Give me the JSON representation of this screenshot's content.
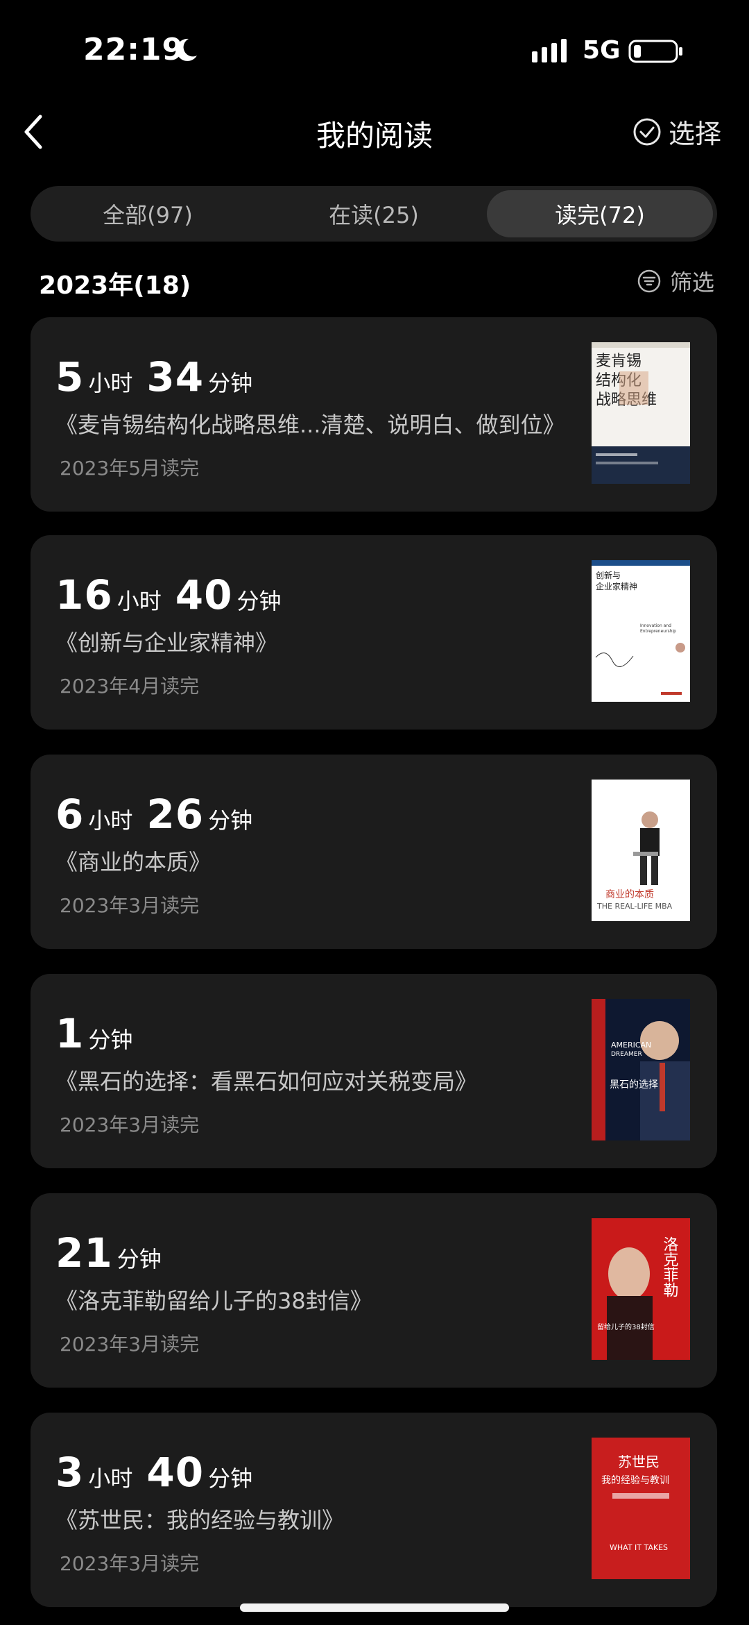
{
  "status": {
    "time": "22:19",
    "network": "5G"
  },
  "nav": {
    "title": "我的阅读",
    "select_label": "选择"
  },
  "tabs": [
    {
      "label": "全部(97)",
      "active": false
    },
    {
      "label": "在读(25)",
      "active": false
    },
    {
      "label": "读完(72)",
      "active": true
    }
  ],
  "section": {
    "year_label": "2023年(18)",
    "filter_label": "筛选"
  },
  "books": [
    {
      "h": "5",
      "h_unit": "小时",
      "m": "34",
      "m_unit": "分钟",
      "title": "《麦肯锡结构化战略思维...清楚、说明白、做到位》",
      "date": "2023年5月读完",
      "cover_text": "麦肯锡结构化战略思维"
    },
    {
      "h": "16",
      "h_unit": "小时",
      "m": "40",
      "m_unit": "分钟",
      "title": "《创新与企业家精神》",
      "date": "2023年4月读完",
      "cover_text": "创新与企业家精神",
      "cover_sub": "Innovation and Entrepreneurship"
    },
    {
      "h": "6",
      "h_unit": "小时",
      "m": "26",
      "m_unit": "分钟",
      "title": "《商业的本质》",
      "date": "2023年3月读完",
      "cover_text": "商业的本质",
      "cover_sub": "THE REAL-LIFE MBA"
    },
    {
      "m": "1",
      "m_unit": "分钟",
      "title": "《黑石的选择：看黑石如何应对关税变局》",
      "date": "2023年3月读完",
      "cover_text": "黑石的选择",
      "cover_sub": "AMERICAN DREAMER"
    },
    {
      "m": "21",
      "m_unit": "分钟",
      "title": "《洛克菲勒留给儿子的38封信》",
      "date": "2023年3月读完",
      "cover_text": "洛克菲勒",
      "cover_sub": "留给儿子的38封信"
    },
    {
      "h": "3",
      "h_unit": "小时",
      "m": "40",
      "m_unit": "分钟",
      "title": "《苏世民：我的经验与教训》",
      "date": "2023年3月读完",
      "cover_text": "苏世民",
      "cover_sub": "我的经验与教训",
      "cover_sub2": "WHAT IT TAKES"
    }
  ]
}
